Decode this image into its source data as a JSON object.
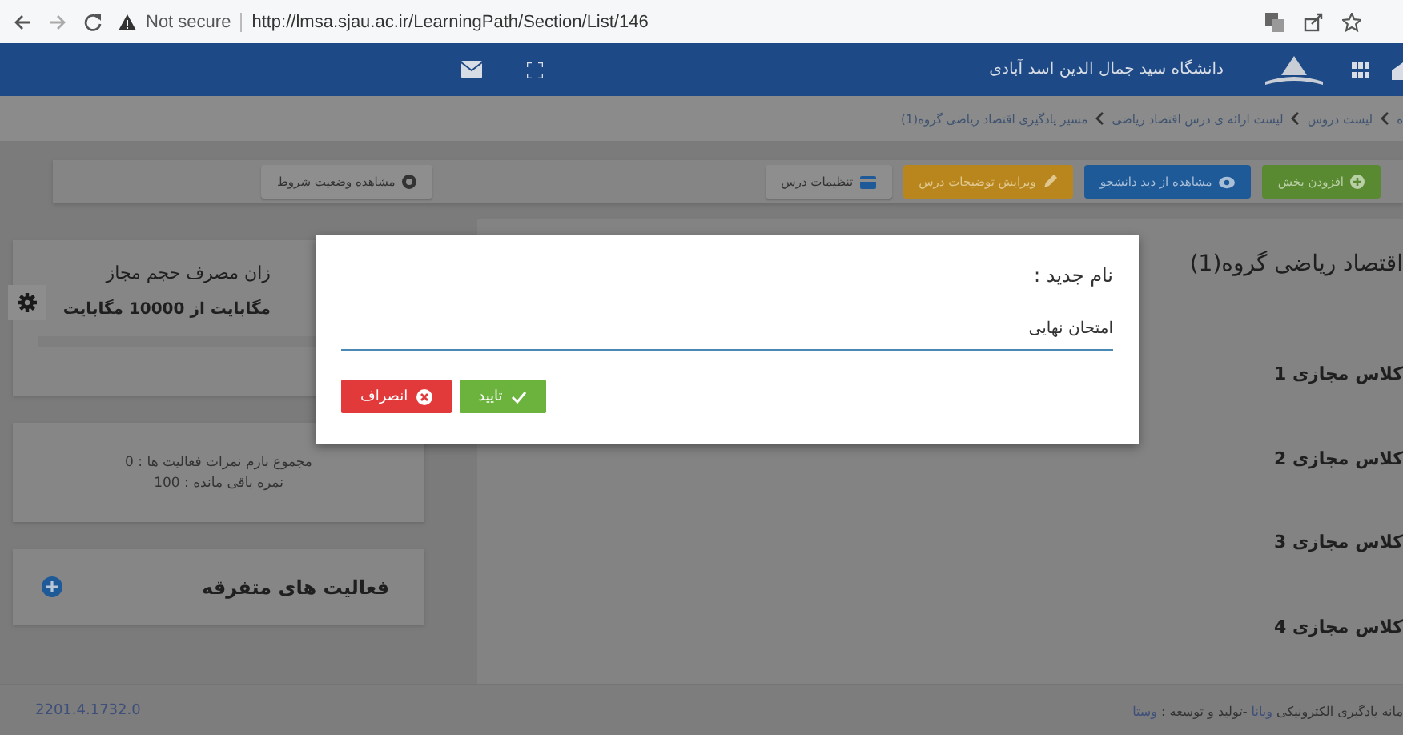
{
  "browser": {
    "security": "Not secure",
    "url": "http://lmsa.sjau.ac.ir/LearningPath/Section/List/146"
  },
  "header": {
    "university": "دانشگاه سید جمال الدین اسد آبادی"
  },
  "breadcrumb": [
    "ه",
    "لیست دروس",
    "لیست ارائه ی درس اقتصاد ریاضی",
    "مسیر یادگیری اقتصاد ریاضی گروه(1)"
  ],
  "toolbar": {
    "buttons": [
      {
        "label": "افزودن بخش",
        "kind": "success"
      },
      {
        "label": "مشاهده از دید دانشجو",
        "kind": "primary"
      },
      {
        "label": "ویرایش توضیحات درس",
        "kind": "warning"
      },
      {
        "label": "تنظیمات درس",
        "kind": "default"
      }
    ],
    "conditions_button": "مشاهده وضعیت شروط"
  },
  "course_title": "اقتصاد ریاضی گروه(1)",
  "sections": [
    "کلاس مجازی 1",
    "کلاس مجازی 2",
    "کلاس مجازی 3",
    "کلاس مجازی 4"
  ],
  "usage": {
    "title": "زان مصرف حجم مجاز",
    "amount": "مگابایت از 10000 مگابایت"
  },
  "grades": [
    "مجموع بارم نمرات فعالیت ها : 0",
    "نمره باقی مانده : 100"
  ],
  "misc": {
    "title": "فعالیت های متفرقه"
  },
  "footer": {
    "version": "2201.4.1732.0",
    "credit": [
      {
        "text": "مانه یادگیری الکترونیکی",
        "kind": "text"
      },
      {
        "text": "ویانا",
        "kind": "link"
      },
      {
        "text": "-تولید و توسعه :",
        "kind": "text"
      },
      {
        "text": "وستا",
        "kind": "link"
      }
    ]
  },
  "dialog": {
    "label": "نام جدید :",
    "value": "امتحان نهایی",
    "buttons": [
      {
        "label": "تایید",
        "kind": "confirm"
      },
      {
        "label": "انصراف",
        "kind": "cancel"
      }
    ]
  }
}
